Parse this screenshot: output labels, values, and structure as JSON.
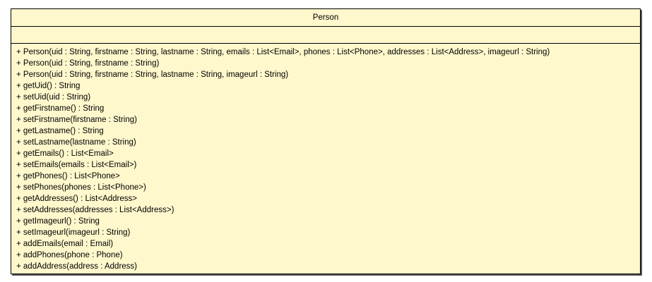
{
  "class_name": "Person",
  "attributes": [],
  "operations": [
    "+ Person(uid : String, firstname : String, lastname : String, emails : List<Email>, phones : List<Phone>, addresses : List<Address>, imageurl : String)",
    "+ Person(uid : String, firstname : String)",
    "+ Person(uid : String, firstname : String, lastname : String, imageurl : String)",
    "+ getUid() : String",
    "+ setUid(uid : String)",
    "+ getFirstname() : String",
    "+ setFirstname(firstname : String)",
    "+ getLastname() : String",
    "+ setLastname(lastname : String)",
    "+ getEmails() : List<Email>",
    "+ setEmails(emails : List<Email>)",
    "+ getPhones() : List<Phone>",
    "+ setPhones(phones : List<Phone>)",
    "+ getAddresses() : List<Address>",
    "+ setAddresses(addresses : List<Address>)",
    "+ getImageurl() : String",
    "+ setImageurl(imageurl : String)",
    "+ addEmails(email : Email)",
    "+ addPhones(phone : Phone)",
    "+ addAddress(address : Address)"
  ],
  "colors": {
    "fill": "#fef8cc",
    "border": "#000000",
    "shadow": "#555555"
  }
}
